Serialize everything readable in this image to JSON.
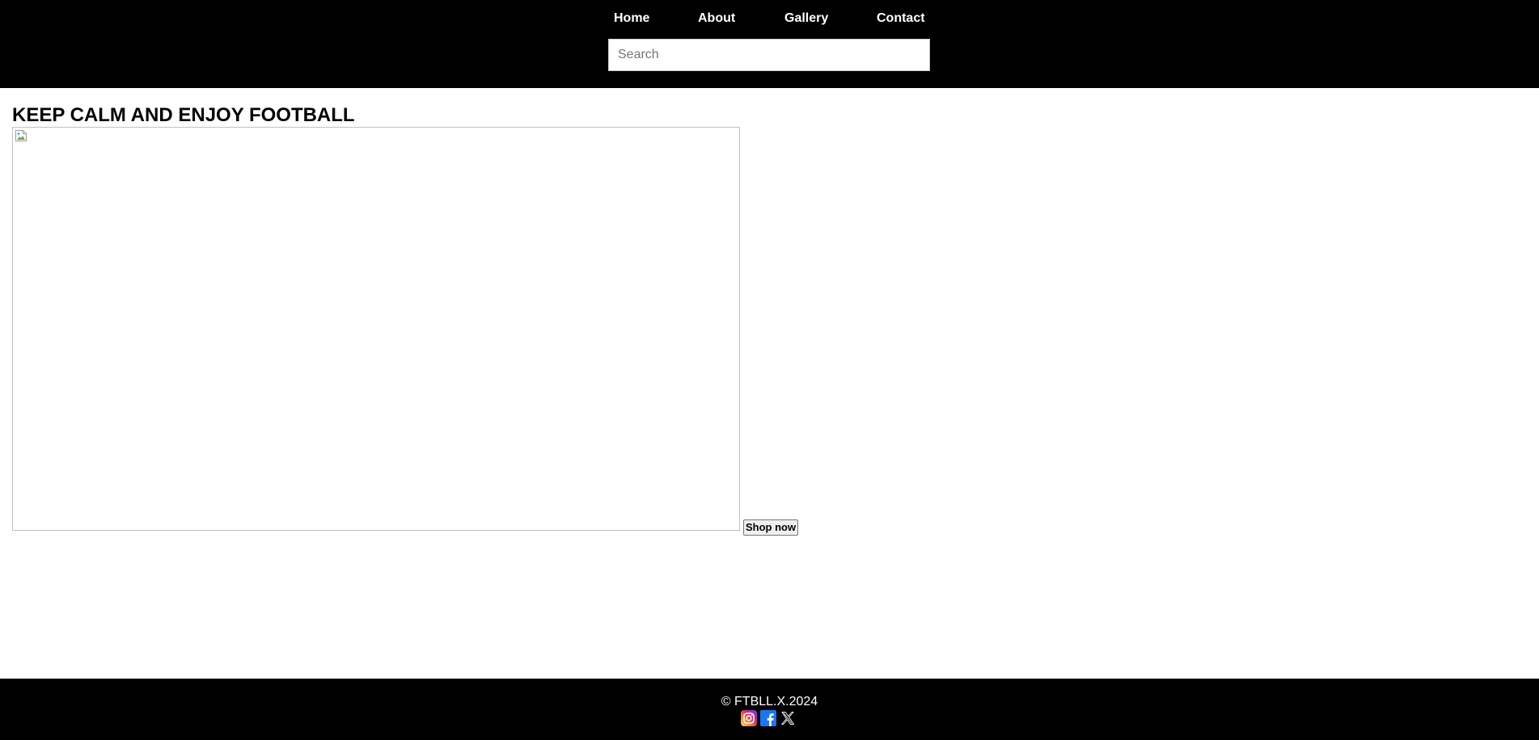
{
  "nav": {
    "items": [
      {
        "label": "Home"
      },
      {
        "label": "About"
      },
      {
        "label": "Gallery"
      },
      {
        "label": "Contact"
      }
    ]
  },
  "search": {
    "placeholder": "Search",
    "value": ""
  },
  "main": {
    "title": "KEEP CALM AND ENJOY FOOTBALL",
    "image": {
      "icon": "broken-image-icon"
    },
    "shop_button": "Shop now"
  },
  "footer": {
    "copyright": "© FTBLL.X.2024",
    "socials": [
      {
        "icon": "instagram-icon"
      },
      {
        "icon": "facebook-icon"
      },
      {
        "icon": "x-icon"
      }
    ]
  },
  "colors": {
    "header_bg": "#000000",
    "footer_bg": "#000000",
    "text_light": "#ffffff",
    "text_dark": "#000000"
  }
}
